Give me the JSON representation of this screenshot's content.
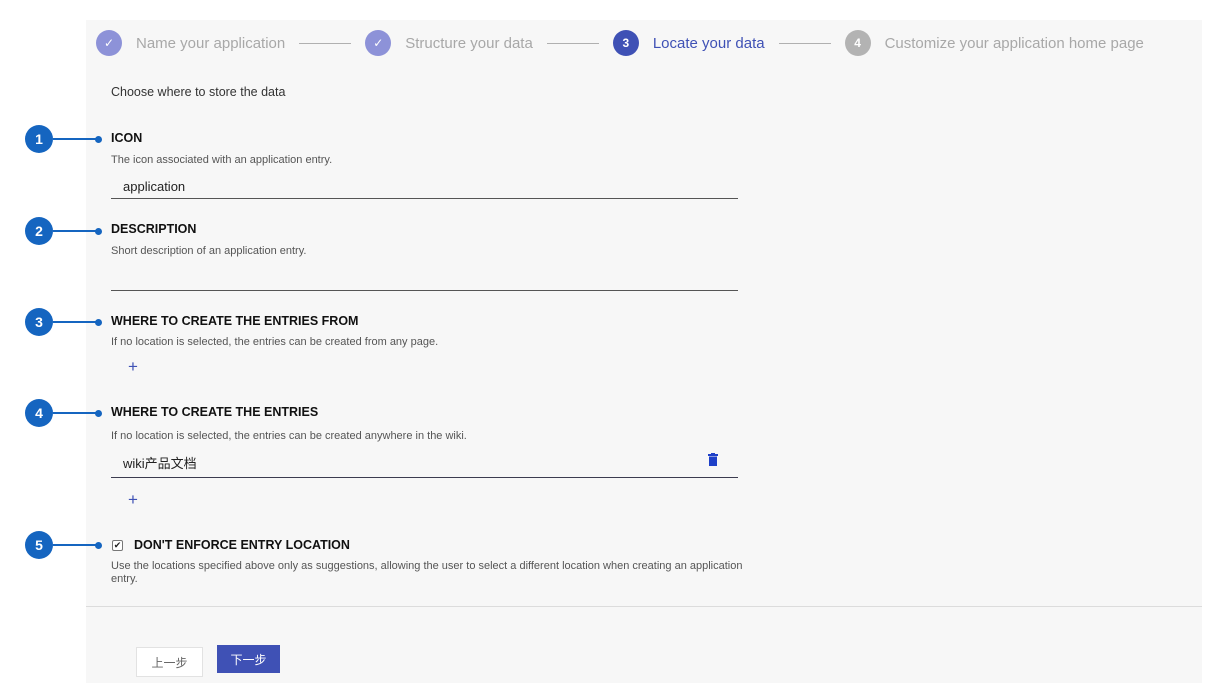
{
  "stepper": {
    "steps": [
      {
        "number": "✓",
        "label": "Name your application",
        "state": "done"
      },
      {
        "number": "✓",
        "label": "Structure your data",
        "state": "done"
      },
      {
        "number": "3",
        "label": "Locate your data",
        "state": "active"
      },
      {
        "number": "4",
        "label": "Customize your application home page",
        "state": "todo"
      }
    ]
  },
  "intro": "Choose where to store the data",
  "callouts": [
    "1",
    "2",
    "3",
    "4",
    "5"
  ],
  "fields": {
    "icon": {
      "title": "ICON",
      "hint": "The icon associated with an application entry.",
      "value": "application"
    },
    "description": {
      "title": "DESCRIPTION",
      "hint": "Short description of an application entry.",
      "value": ""
    },
    "create_from": {
      "title": "WHERE TO CREATE THE ENTRIES FROM",
      "hint": "If no location is selected, the entries can be created from any page.",
      "add_label": "+"
    },
    "create_in": {
      "title": "WHERE TO CREATE THE ENTRIES",
      "hint": "If no location is selected, the entries can be created anywhere in the wiki.",
      "value": "wiki产品文档",
      "add_label": "+"
    }
  },
  "enforce": {
    "checked": true,
    "check_glyph": "✔",
    "title": "DON'T ENFORCE ENTRY LOCATION",
    "hint": "Use the locations specified above only as suggestions, allowing the user to select a different location when creating an application entry."
  },
  "buttons": {
    "prev": "上一步",
    "next": "下一步"
  },
  "colors": {
    "accent": "#3f51b5",
    "callout": "#1565c0",
    "done_step": "#8d92d8",
    "todo_step": "#b3b3b3"
  }
}
